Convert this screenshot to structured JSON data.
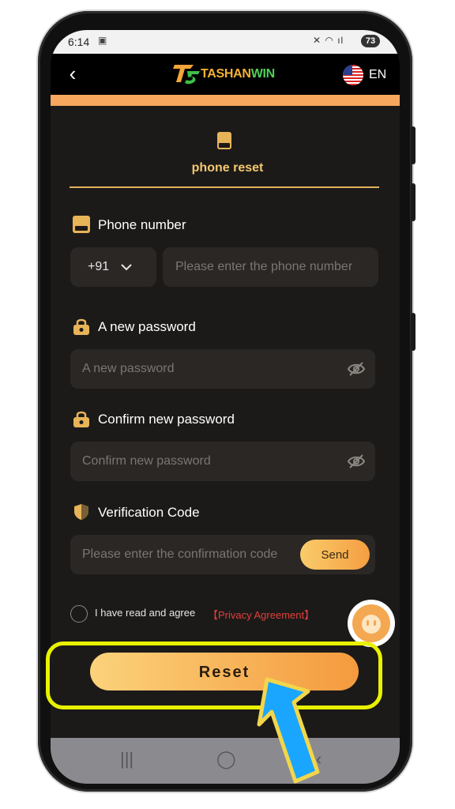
{
  "status": {
    "time": "6:14",
    "battery": "73"
  },
  "header": {
    "back_symbol": "‹",
    "brand": "TASHAN",
    "brand_accent": "WIN",
    "language": "EN"
  },
  "tab": {
    "label": "phone reset"
  },
  "phone": {
    "label": "Phone number",
    "country_code": "+91",
    "placeholder": "Please enter the phone number"
  },
  "password": {
    "label": "A new password",
    "placeholder": "A new password"
  },
  "confirm": {
    "label": "Confirm new password",
    "placeholder": "Confirm new password"
  },
  "verification": {
    "label": "Verification Code",
    "placeholder": "Please enter the confirmation code",
    "send_label": "Send"
  },
  "agreement": {
    "text": "I have read and agree",
    "link": "【Privacy Agreement】"
  },
  "reset": {
    "label": "Reset"
  },
  "colors": {
    "accent": "#f7a85e",
    "background": "#1c1a19",
    "link": "#e0403a",
    "highlight": "#e8f200",
    "arrow": "#1aa6ff"
  },
  "icons": [
    "back-icon",
    "flag-us-icon",
    "phone-icon",
    "lock-icon",
    "shield-icon",
    "eye-off-icon",
    "chevron-down-icon",
    "support-bot-icon",
    "pointer-arrow-icon"
  ]
}
